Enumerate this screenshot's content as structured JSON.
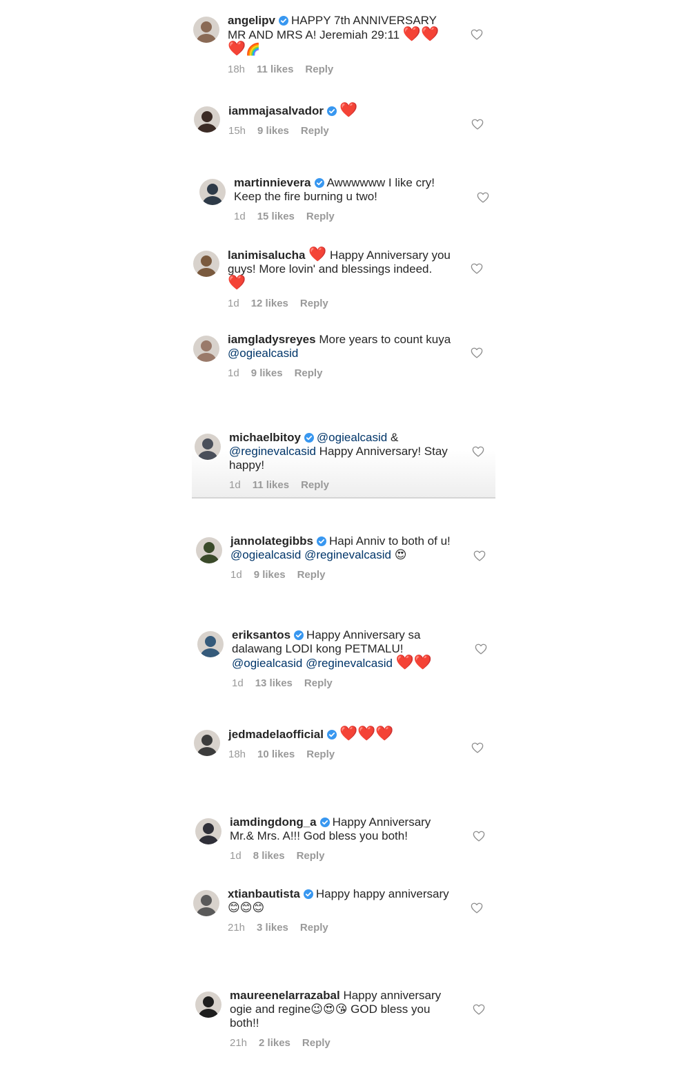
{
  "comments": [
    {
      "username": "angelipv",
      "verified": true,
      "avatar_color": "#8a6a55",
      "text_parts": [
        {
          "t": "text",
          "v": "HAPPY 7th ANNIVERSARY MR AND MRS A! Jeremiah 29:11 "
        },
        {
          "t": "heart",
          "v": "❤️"
        },
        {
          "t": "heart",
          "v": "❤️"
        },
        {
          "t": "heart",
          "v": "❤️"
        },
        {
          "t": "emoji",
          "v": "🌈"
        }
      ],
      "age": "18h",
      "likes": "11 likes",
      "reply": "Reply"
    },
    {
      "username": "iammajasalvador",
      "verified": true,
      "avatar_color": "#3b2b25",
      "text_parts": [
        {
          "t": "heart",
          "v": "❤️"
        }
      ],
      "age": "15h",
      "likes": "9 likes",
      "reply": "Reply"
    },
    {
      "username": "martinnievera",
      "verified": true,
      "avatar_color": "#2e3a48",
      "text_parts": [
        {
          "t": "text",
          "v": "Awwwwww I like cry! Keep the fire burning u two!"
        }
      ],
      "age": "1d",
      "likes": "15 likes",
      "reply": "Reply"
    },
    {
      "username": "lanimisalucha",
      "verified": false,
      "avatar_color": "#7a5a3e",
      "text_parts": [
        {
          "t": "heart",
          "v": "❤️"
        },
        {
          "t": "text",
          "v": " Happy Anniversary you guys! More lovin' and blessings indeed. "
        },
        {
          "t": "heart",
          "v": "❤️"
        }
      ],
      "age": "1d",
      "likes": "12 likes",
      "reply": "Reply"
    },
    {
      "username": "iamgladysreyes",
      "verified": false,
      "avatar_color": "#9a7a6a",
      "text_parts": [
        {
          "t": "text",
          "v": "More years to count kuya "
        },
        {
          "t": "mention",
          "v": "@ogiealcasid"
        }
      ],
      "age": "1d",
      "likes": "9 likes",
      "reply": "Reply"
    },
    {
      "username": "michaelbitoy",
      "verified": true,
      "avatar_color": "#4a4f5a",
      "text_parts": [
        {
          "t": "mention",
          "v": "@ogiealcasid"
        },
        {
          "t": "text",
          "v": " & "
        },
        {
          "t": "mention",
          "v": "@reginevalcasid"
        },
        {
          "t": "text",
          "v": " Happy Anniversary! Stay happy!"
        }
      ],
      "age": "1d",
      "likes": "11 likes",
      "reply": "Reply"
    },
    {
      "username": "jannolategibbs",
      "verified": true,
      "avatar_color": "#3a4a2a",
      "text_parts": [
        {
          "t": "text",
          "v": "Hapi Anniv to both of u! "
        },
        {
          "t": "mention",
          "v": "@ogiealcasid"
        },
        {
          "t": "text",
          "v": " "
        },
        {
          "t": "mention",
          "v": "@reginevalcasid"
        },
        {
          "t": "text",
          "v": " "
        },
        {
          "t": "emoji",
          "v": "😍"
        }
      ],
      "age": "1d",
      "likes": "9 likes",
      "reply": "Reply"
    },
    {
      "username": "eriksantos",
      "verified": true,
      "avatar_color": "#355a7a",
      "text_parts": [
        {
          "t": "text",
          "v": "Happy Anniversary sa dalawang LODI kong PETMALU! "
        },
        {
          "t": "mention",
          "v": "@ogiealcasid"
        },
        {
          "t": "text",
          "v": " "
        },
        {
          "t": "mention",
          "v": "@reginevalcasid"
        },
        {
          "t": "text",
          "v": " "
        },
        {
          "t": "heart",
          "v": "❤️"
        },
        {
          "t": "heart",
          "v": "❤️"
        }
      ],
      "age": "1d",
      "likes": "13 likes",
      "reply": "Reply"
    },
    {
      "username": "jedmadelaofficial",
      "verified": true,
      "avatar_color": "#3c3c3c",
      "text_parts": [
        {
          "t": "heart",
          "v": "❤️"
        },
        {
          "t": "heart",
          "v": "❤️"
        },
        {
          "t": "heart",
          "v": "❤️"
        }
      ],
      "age": "18h",
      "likes": "10 likes",
      "reply": "Reply"
    },
    {
      "username": "iamdingdong_a",
      "verified": true,
      "avatar_color": "#2f2f38",
      "text_parts": [
        {
          "t": "text",
          "v": "Happy Anniversary Mr.& Mrs. A!!! God bless you both!"
        }
      ],
      "age": "1d",
      "likes": "8 likes",
      "reply": "Reply"
    },
    {
      "username": "xtianbautista",
      "verified": true,
      "avatar_color": "#5a5a5a",
      "text_parts": [
        {
          "t": "text",
          "v": "Happy happy anniversary "
        },
        {
          "t": "emoji",
          "v": "😊"
        },
        {
          "t": "emoji",
          "v": "😊"
        },
        {
          "t": "emoji",
          "v": "😊"
        }
      ],
      "age": "21h",
      "likes": "3 likes",
      "reply": "Reply"
    },
    {
      "username": "maureenelarrazabal",
      "verified": false,
      "avatar_color": "#1e1e1e",
      "text_parts": [
        {
          "t": "text",
          "v": "Happy anniversary ogie and regine"
        },
        {
          "t": "emoji",
          "v": "😉"
        },
        {
          "t": "emoji",
          "v": "😍"
        },
        {
          "t": "emoji",
          "v": "😘"
        },
        {
          "t": "text",
          "v": " GOD bless you both!!"
        }
      ],
      "age": "21h",
      "likes": "2 likes",
      "reply": "Reply"
    }
  ],
  "icons": {
    "verified": "verified-badge-icon",
    "like": "heart-outline-icon"
  },
  "colors": {
    "verified": "#3897f0",
    "mention": "#003569",
    "meta": "#999999"
  }
}
